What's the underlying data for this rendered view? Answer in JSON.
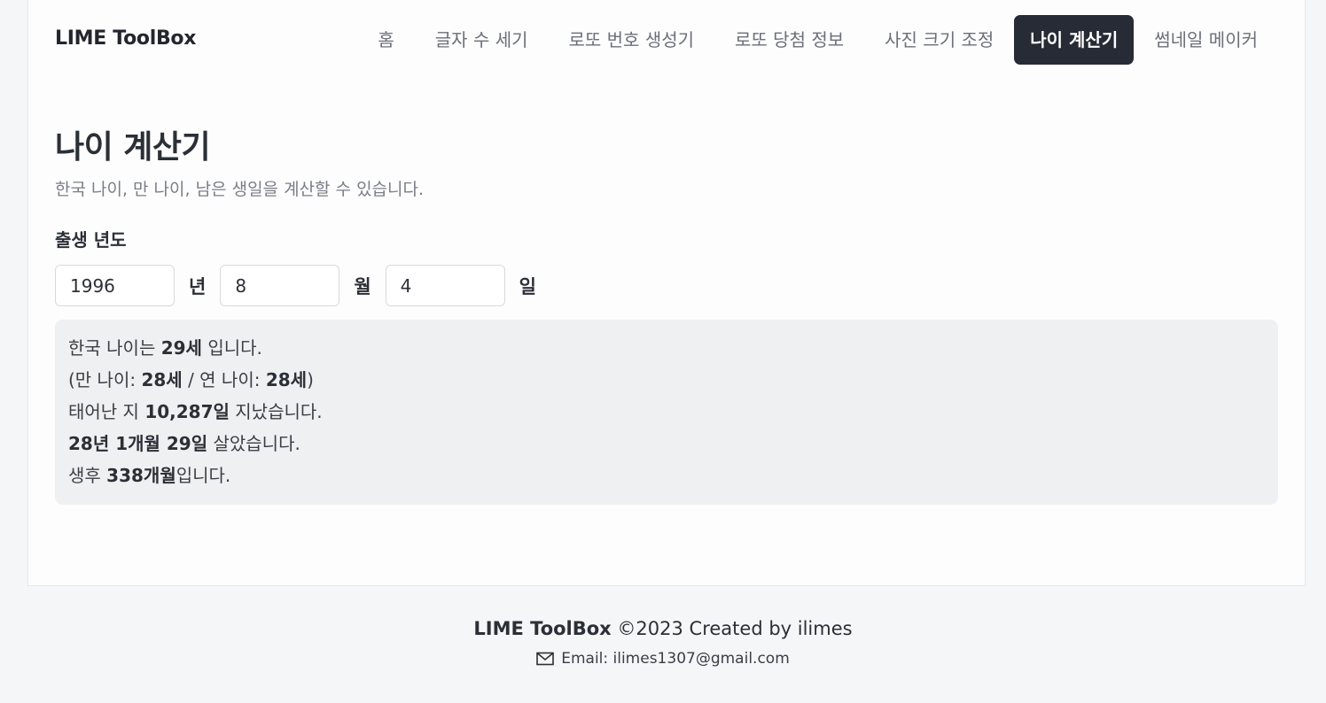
{
  "brand": "LIME ToolBox",
  "nav": {
    "items": [
      {
        "label": "홈"
      },
      {
        "label": "글자 수 세기"
      },
      {
        "label": "로또 번호 생성기"
      },
      {
        "label": "로또 당첨 정보"
      },
      {
        "label": "사진 크기 조정"
      },
      {
        "label": "나이 계산기",
        "active": true
      },
      {
        "label": "썸네일 메이커"
      }
    ]
  },
  "page": {
    "title": "나이 계산기",
    "description": "한국 나이, 만 나이, 남은 생일을 계산할 수 있습니다."
  },
  "birth": {
    "label": "출생 년도",
    "year": "1996",
    "year_unit": "년",
    "month": "8",
    "month_unit": "월",
    "day": "4",
    "day_unit": "일"
  },
  "result": {
    "korean_age_prefix": "한국 나이는",
    "korean_age": "29세",
    "korean_age_suffix": "입니다.",
    "full_age_prefix": "(만 나이:",
    "full_age": "28세",
    "year_age_prefix": "/ 연 나이:",
    "year_age": "28세",
    "year_age_suffix": ")",
    "days_prefix": "태어난 지",
    "days": "10,287일",
    "days_suffix": "지났습니다.",
    "lived": "28년 1개월 29일",
    "lived_suffix": "살았습니다.",
    "months_prefix": "생후",
    "months": "338개월",
    "months_suffix": "입니다."
  },
  "footer": {
    "brand": "LIME ToolBox",
    "copyright": "©2023 Created by ilimes",
    "email": "Email: ilimes1307@gmail.com",
    "email_icon": "mail-icon"
  }
}
